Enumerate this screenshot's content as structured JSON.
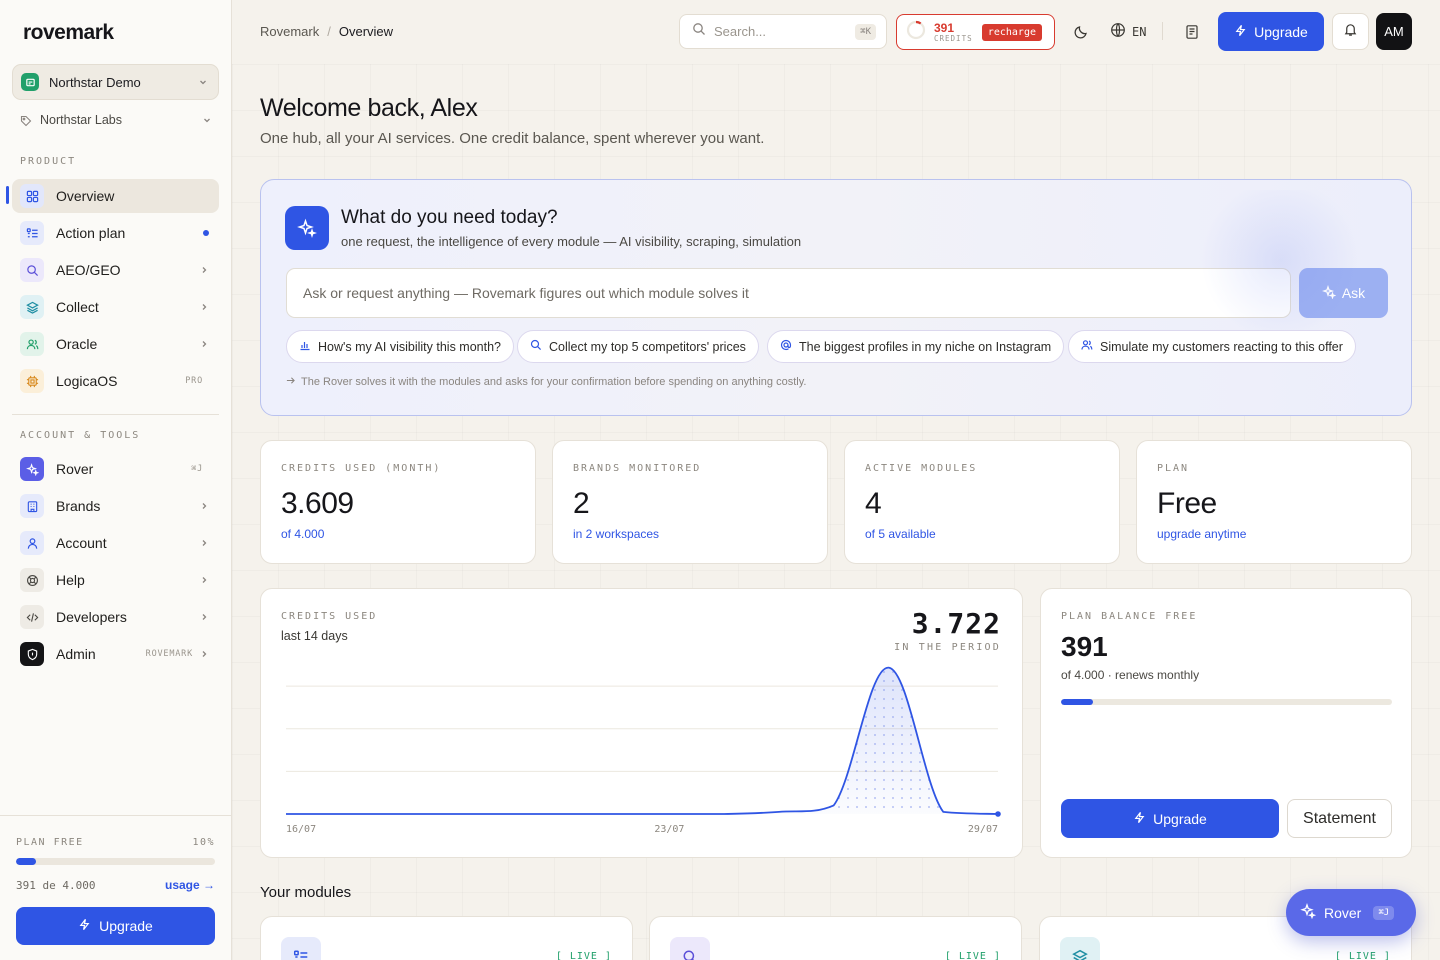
{
  "app": {
    "logo": "rovemark",
    "workspace": "Northstar Demo",
    "organization": "Northstar Labs"
  },
  "sidebar": {
    "product_label": "PRODUCT",
    "product_items": [
      {
        "label": "Overview",
        "tag": ""
      },
      {
        "label": "Action plan",
        "tag": ""
      },
      {
        "label": "AEO/GEO",
        "tag": ""
      },
      {
        "label": "Collect",
        "tag": ""
      },
      {
        "label": "Oracle",
        "tag": ""
      },
      {
        "label": "LogicaOS",
        "tag": "PRO"
      }
    ],
    "account_label": "ACCOUNT & TOOLS",
    "account_items": [
      {
        "label": "Rover",
        "tag": "⌘J"
      },
      {
        "label": "Brands",
        "tag": ""
      },
      {
        "label": "Account",
        "tag": ""
      },
      {
        "label": "Help",
        "tag": ""
      },
      {
        "label": "Developers",
        "tag": ""
      },
      {
        "label": "Admin",
        "tag": "ROVEMARK"
      }
    ],
    "footer": {
      "plan_label": "PLAN FREE",
      "percent": "10%",
      "progress": 0.1,
      "usage_text": "391 de 4.000",
      "usage_link": "usage →",
      "upgrade_label": "Upgrade"
    }
  },
  "topbar": {
    "breadcrumb": [
      "Rovemark",
      "Overview"
    ],
    "breadcrumb_sep": "/",
    "search_placeholder": "Search...",
    "search_kbd": "⌘K",
    "credits_value": "391",
    "credits_label": "CREDITS",
    "recharge_label": "recharge",
    "language": "EN",
    "upgrade_label": "Upgrade",
    "avatar_initials": "AM"
  },
  "welcome": {
    "title": "Welcome back, Alex",
    "subtitle": "One hub, all your AI services. One credit balance, spent wherever you want."
  },
  "ask": {
    "title": "What do you need today?",
    "subtitle": "one request, the intelligence of every module — AI visibility, scraping, simulation",
    "placeholder": "Ask or request anything — Rovemark figures out which module solves it",
    "button_label": "Ask",
    "chips": [
      "How's my AI visibility this month?",
      "Collect my top 5 competitors' prices",
      "The biggest profiles in my niche on Instagram",
      "Simulate my customers reacting to this offer"
    ],
    "note": "The Rover solves it with the modules and asks for your confirmation before spending on anything costly."
  },
  "stats": [
    {
      "label": "CREDITS USED (MONTH)",
      "value": "3.609",
      "sub": "of 4.000"
    },
    {
      "label": "BRANDS MONITORED",
      "value": "2",
      "sub": "in 2 workspaces"
    },
    {
      "label": "ACTIVE MODULES",
      "value": "4",
      "sub": "of 5 available"
    },
    {
      "label": "PLAN",
      "value": "Free",
      "sub": "upgrade anytime"
    }
  ],
  "credits_chart": {
    "label": "CREDITS USED",
    "sublabel": "last 14 days",
    "total": "3.722",
    "total_label": "IN THE PERIOD"
  },
  "chart_data": {
    "type": "area",
    "title": "",
    "x": [
      "16/07",
      "17/07",
      "18/07",
      "19/07",
      "20/07",
      "21/07",
      "22/07",
      "23/07",
      "24/07",
      "25/07",
      "26/07",
      "27/07",
      "28/07",
      "29/07"
    ],
    "tick_labels": [
      "16/07",
      "23/07",
      "29/07"
    ],
    "series": [
      {
        "values": [
          0,
          0,
          0,
          0,
          0,
          0,
          0,
          0,
          0,
          5,
          20,
          340,
          5,
          0
        ]
      }
    ],
    "ylim": [
      0,
      360
    ],
    "grid": true,
    "color": "#2f55e4"
  },
  "balance": {
    "label": "PLAN BALANCE FREE",
    "value": "391",
    "sub": "of 4.000 · renews monthly",
    "progress": 0.0978,
    "upgrade_label": "Upgrade",
    "statement_label": "Statement"
  },
  "modules": {
    "title": "Your modules",
    "tag": "[ LIVE ]"
  },
  "rover_fab": {
    "label": "Rover",
    "kbd": "⌘J"
  },
  "colors": {
    "accent": "#2f55e4",
    "danger": "#d83b2f",
    "success": "#22a06b"
  }
}
